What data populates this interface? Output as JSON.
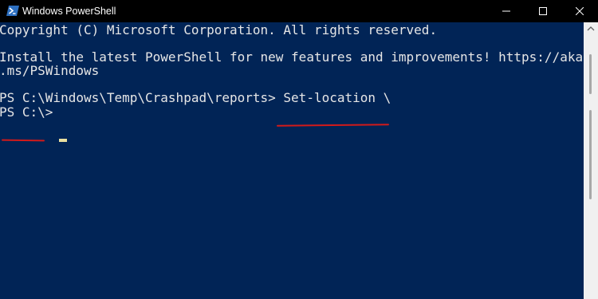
{
  "window": {
    "title": "Windows PowerShell",
    "icon": "powershell-icon"
  },
  "controls": {
    "minimize_icon": "minimize-icon",
    "maximize_icon": "maximize-icon",
    "close_icon": "close-icon"
  },
  "console": {
    "lines": [
      "Copyright (C) Microsoft Corporation. All rights reserved.",
      "Install the latest PowerShell for new features and improvements! https://aka",
      ".ms/PSWindows",
      "PS C:\\Windows\\Temp\\Crashpad\\reports> Set-location \\",
      "PS C:\\>"
    ],
    "background_color": "#012456",
    "text_color": "#e6e6e6",
    "cursor_color": "#eadfa0",
    "annotation_color": "#d21a1a"
  }
}
